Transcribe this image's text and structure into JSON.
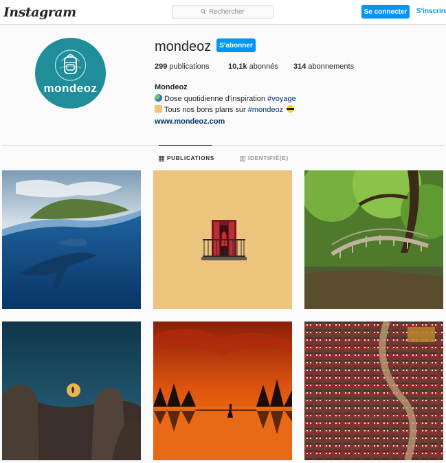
{
  "nav": {
    "logo": "Instagram",
    "search_placeholder": "Rechercher",
    "login_label": "Se connecter",
    "signup_label": "S'inscrire"
  },
  "profile": {
    "avatar_text": "mondeoz",
    "username": "mondeoz",
    "follow_label": "S'abonner",
    "stats": [
      {
        "count": "299",
        "label": "publications"
      },
      {
        "count": "10,1k",
        "label": "abonnés"
      },
      {
        "count": "314",
        "label": "abonnements"
      }
    ],
    "full_name": "Mondeoz",
    "bio_line1_text": "Dose quotidienne d'inspiration ",
    "bio_line1_tag": "#voyage",
    "bio_line2_text": "Tous nos bons plans sur ",
    "bio_line2_tag": "#mondeoz",
    "website": "www.mondeoz.com"
  },
  "tabs": [
    {
      "label": "PUBLICATIONS",
      "icon": "grid-icon",
      "active": true
    },
    {
      "label": "IDENTIFIÉ(E)",
      "icon": "tagged-icon",
      "active": false
    }
  ],
  "posts": [
    {
      "subject": "whale-underwater"
    },
    {
      "subject": "balcony-yellow-wall"
    },
    {
      "subject": "forest-bridge"
    },
    {
      "subject": "moon-rocks"
    },
    {
      "subject": "orange-sunset-lake"
    },
    {
      "subject": "red-houses-hillside"
    }
  ],
  "colors": {
    "accent": "#0095f6",
    "avatar_bg": "#1f8e9a",
    "link": "#00376b"
  }
}
